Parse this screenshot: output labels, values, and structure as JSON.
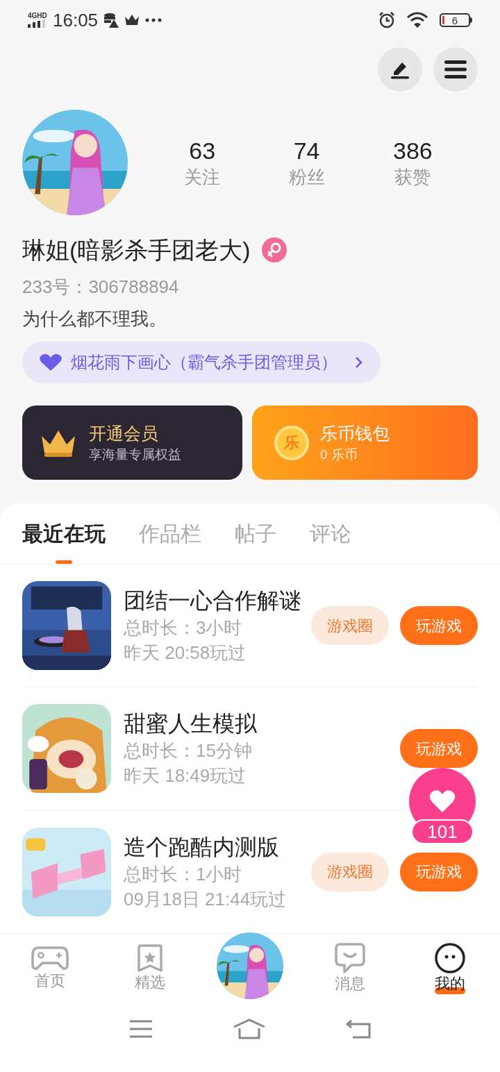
{
  "status_bar": {
    "network": "4GHD",
    "time": "16:05",
    "battery": "6"
  },
  "profile": {
    "stats": [
      {
        "value": "63",
        "label": "关注"
      },
      {
        "value": "74",
        "label": "粉丝"
      },
      {
        "value": "386",
        "label": "获赞"
      }
    ],
    "name": "琳姐(暗影杀手团老大)",
    "id": "233号：306788894",
    "bio": "为什么都不理我。",
    "badge": "烟花雨下画心（霸气杀手团管理员）"
  },
  "cards": [
    {
      "kind": "vip",
      "title": "开通会员",
      "subtitle": "享海量专属权益"
    },
    {
      "kind": "wallet",
      "title": "乐币钱包",
      "subtitle": "0 乐币",
      "coin_glyph": "乐"
    }
  ],
  "tabs": [
    {
      "label": "最近在玩",
      "selected": true
    },
    {
      "label": "作品栏",
      "selected": false
    },
    {
      "label": "帖子",
      "selected": false
    },
    {
      "label": "评论",
      "selected": false
    }
  ],
  "games": [
    {
      "title": "团结一心合作解谜",
      "duration": "总时长：3小时",
      "last_played": "昨天 20:58玩过",
      "circle": "游戏圈",
      "play": "玩游戏"
    },
    {
      "title": "甜蜜人生模拟",
      "duration": "总时长：15分钟",
      "last_played": "昨天 18:49玩过",
      "play": "玩游戏"
    },
    {
      "title": "造个跑酷内测版",
      "duration": "总时长：1小时",
      "last_played": "09月18日 21:44玩过",
      "circle": "游戏圈",
      "play": "玩游戏"
    }
  ],
  "floating_like": {
    "count": "101"
  },
  "bottom_nav": [
    {
      "kind": "home",
      "label": "首页",
      "selected": false
    },
    {
      "kind": "featured",
      "label": "精选",
      "selected": false
    },
    {
      "kind": "avatar"
    },
    {
      "kind": "messages",
      "label": "消息",
      "selected": false
    },
    {
      "kind": "me",
      "label": "我的",
      "selected": true
    }
  ]
}
